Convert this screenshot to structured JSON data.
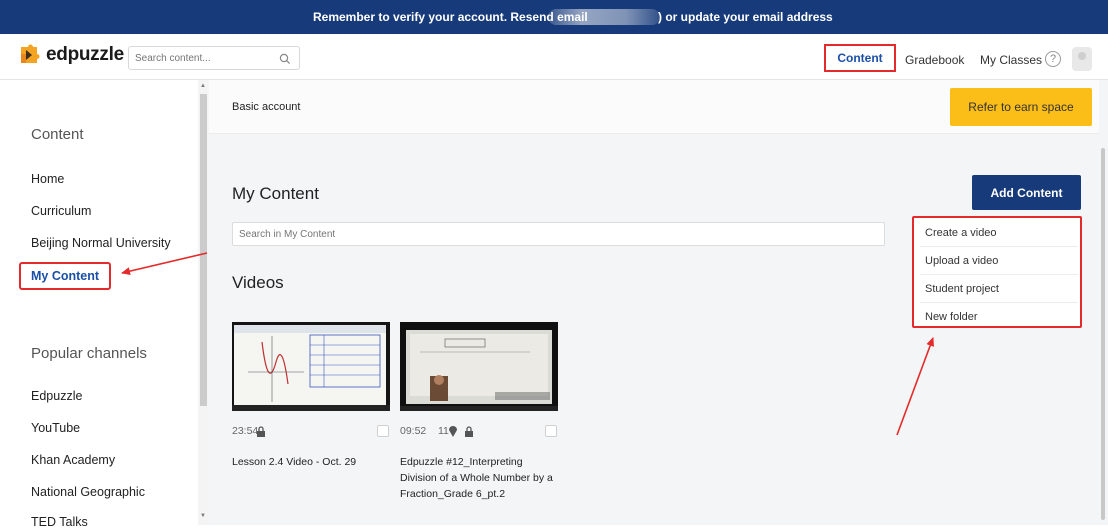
{
  "banner": {
    "text_before": "Remember to verify your account. Resend email",
    "text_after": ") or update your email address"
  },
  "header": {
    "logo_text": "edpuzzle",
    "search_placeholder": "Search content...",
    "nav": {
      "content": "Content",
      "gradebook": "Gradebook",
      "my_classes": "My Classes",
      "help": "?"
    }
  },
  "sidebar": {
    "content_heading": "Content",
    "items": [
      "Home",
      "Curriculum",
      "Beijing Normal University"
    ],
    "active_item": "My Content",
    "channels_heading": "Popular channels",
    "channels": [
      "Edpuzzle",
      "YouTube",
      "Khan Academy",
      "National Geographic",
      "TED Talks"
    ]
  },
  "account": {
    "label": "Basic account",
    "refer_button": "Refer to earn space"
  },
  "main": {
    "title": "My Content",
    "add_button": "Add Content",
    "search_placeholder": "Search in My Content",
    "videos_heading": "Videos"
  },
  "dropdown": {
    "items": [
      "Create a video",
      "Upload a video",
      "Student project",
      "New folder"
    ]
  },
  "videos": [
    {
      "duration": "23:54",
      "questions": "",
      "title": "Lesson 2.4 Video - Oct. 29"
    },
    {
      "duration": "09:52",
      "questions": "11",
      "title": "Edpuzzle #12_Interpreting Division of a Whole Number by a Fraction_Grade 6_pt.2"
    }
  ],
  "colors": {
    "banner": "#163a7a",
    "accent_blue": "#1a4fa8",
    "refer_yellow": "#fbbd18",
    "annotation_red": "#e42a2a"
  }
}
